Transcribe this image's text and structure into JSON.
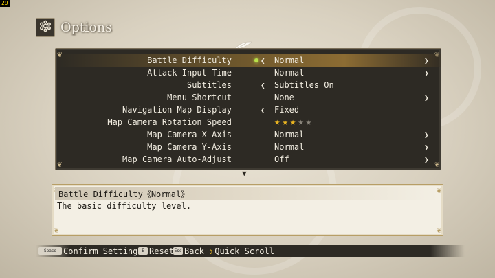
{
  "fps_counter": "29",
  "header": {
    "title": "Options",
    "icon": "gear-icon"
  },
  "options": [
    {
      "label": "Battle Difficulty",
      "value": "Normal",
      "left_arrow": true,
      "right_arrow": true,
      "selected": true
    },
    {
      "label": "Attack Input Time",
      "value": "Normal",
      "left_arrow": false,
      "right_arrow": true
    },
    {
      "label": "Subtitles",
      "value": "Subtitles On",
      "left_arrow": true,
      "right_arrow": false
    },
    {
      "label": "Menu Shortcut",
      "value": "None",
      "left_arrow": false,
      "right_arrow": true
    },
    {
      "label": "Navigation Map Display",
      "value": "Fixed",
      "left_arrow": true,
      "right_arrow": false
    },
    {
      "label": "Map Camera Rotation Speed",
      "stars": 3,
      "stars_max": 5
    },
    {
      "label": "Map Camera X-Axis",
      "value": "Normal",
      "left_arrow": false,
      "right_arrow": true
    },
    {
      "label": "Map Camera Y-Axis",
      "value": "Normal",
      "left_arrow": false,
      "right_arrow": true
    },
    {
      "label": "Map Camera Auto-Adjust",
      "value": "Off",
      "left_arrow": false,
      "right_arrow": true
    }
  ],
  "description": {
    "title": "Battle Difficulty《Normal》",
    "text": "The basic difficulty level."
  },
  "footer": {
    "confirm": {
      "key": "Space",
      "label": "Confirm Settings"
    },
    "reset": {
      "key": "E",
      "label": "Reset"
    },
    "back": {
      "key": "Esc",
      "label": "Back"
    },
    "scroll": {
      "label": "Quick Scroll"
    }
  },
  "colors": {
    "panel_bg": "#2d2a24",
    "selection": "#8c6c33",
    "star_on": "#e8b321",
    "star_off": "#8a857b",
    "desc_bg": "#f3efe4"
  }
}
